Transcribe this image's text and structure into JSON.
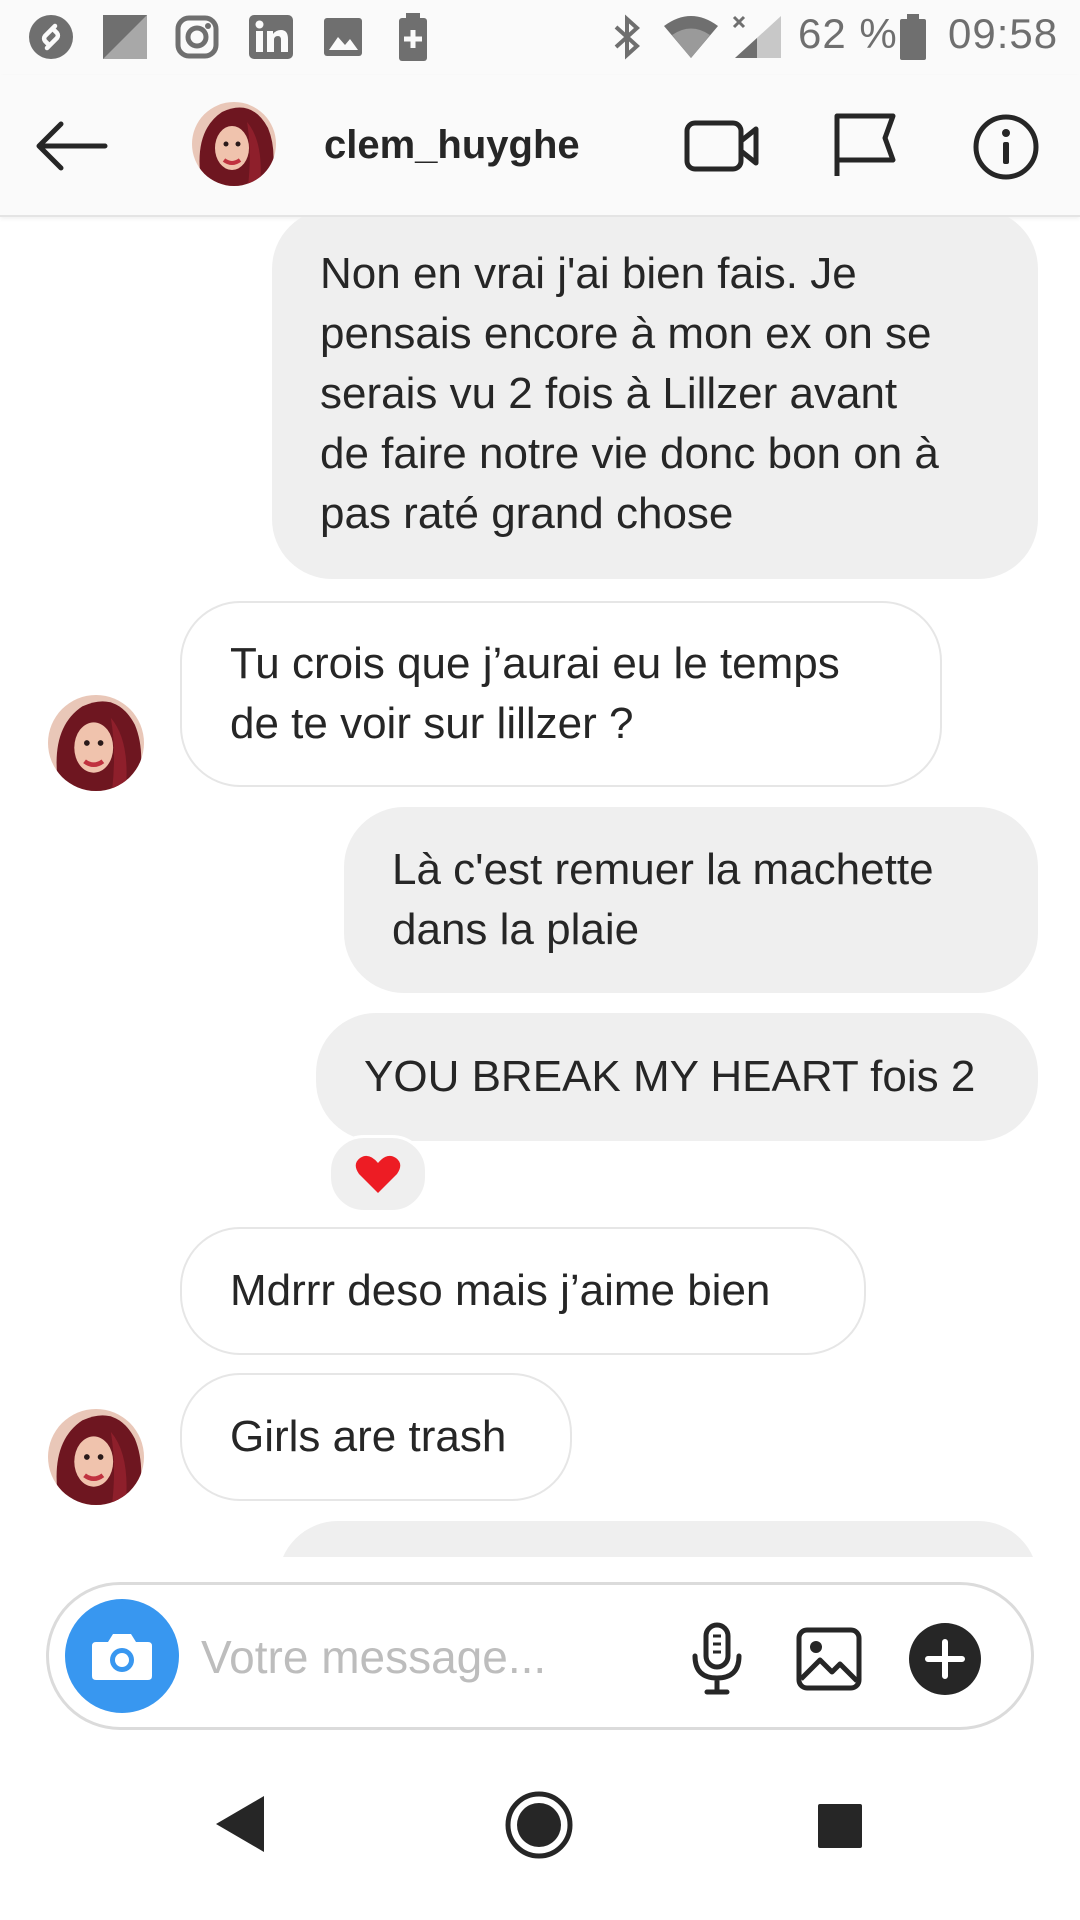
{
  "status_bar": {
    "battery_percent": "62 %",
    "time": "09:58",
    "left_icons": [
      "shazam-icon",
      "app-icon",
      "instagram-icon",
      "linkedin-icon",
      "gallery-icon",
      "battery-plus-icon"
    ],
    "right_icons": [
      "bluetooth-icon",
      "wifi-icon",
      "signal-icon",
      "battery-icon"
    ]
  },
  "header": {
    "username": "clem_huyghe",
    "icons": [
      "back-arrow-icon",
      "video-call-icon",
      "flag-icon",
      "info-icon"
    ]
  },
  "messages": [
    {
      "sender": "me",
      "lines": [
        "Non en vrai j'ai bien fais. Je",
        "pensais encore à mon ex on se",
        "serais vu 2 fois à Lillzer avant",
        "de faire notre vie donc bon on à",
        "pas raté grand chose"
      ]
    },
    {
      "sender": "them",
      "lines": [
        "Tu crois que j’aurai eu le temps",
        "de te voir sur lillzer ?"
      ]
    },
    {
      "sender": "me",
      "lines": [
        "Là c'est remuer la machette",
        "dans la plaie"
      ]
    },
    {
      "sender": "me",
      "lines": [
        "YOU BREAK MY HEART fois 2"
      ],
      "reaction": "❤️"
    },
    {
      "sender": "them",
      "lines": [
        "Mdrrr deso mais j’aime bien"
      ]
    },
    {
      "sender": "them",
      "lines": [
        "Girls are trash"
      ]
    }
  ],
  "composer": {
    "placeholder": "Votre message...",
    "icons": [
      "camera-icon",
      "microphone-icon",
      "image-icon",
      "plus-icon"
    ]
  },
  "nav_bar": {
    "icons": [
      "back-triangle-icon",
      "home-circle-icon",
      "recents-square-icon"
    ]
  },
  "colors": {
    "accent_blue": "#3897f0",
    "bubble_mine": "#efefef",
    "bubble_border": "#e6e6e6",
    "text": "#262626",
    "heart": "#ed1c24"
  }
}
